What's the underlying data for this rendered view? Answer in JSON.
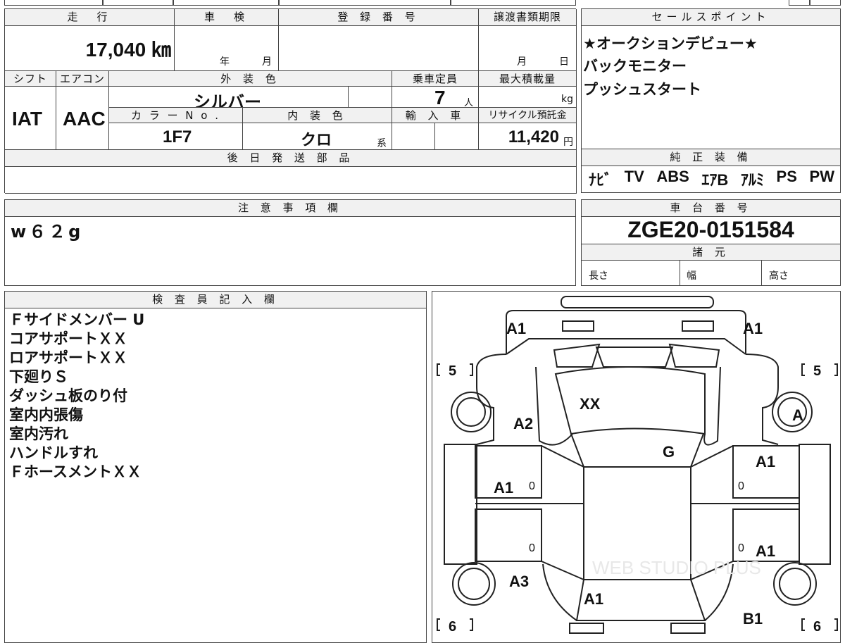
{
  "vehicle": {
    "mileage_label": "走　行",
    "mileage": "17,040 ㎞",
    "inspection_label": "車　検",
    "inspection_year": "年",
    "inspection_month": "月",
    "registration_label": "登 録 番 号",
    "deadline_label": "譲渡書類期限",
    "deadline_month": "月",
    "deadline_day": "日",
    "shift_label": "シフト",
    "shift": "IAT",
    "ac_label": "エアコン",
    "ac": "AAC",
    "exterior_label": "外 装 色",
    "exterior": "シルバー",
    "capacity_label": "乗車定員",
    "capacity": "7",
    "capacity_unit": "人",
    "load_label": "最大積載量",
    "load_unit": "kg",
    "color_no_label": "カ ラ ー N o .",
    "color_no": "1F7",
    "interior_label": "内 装 色",
    "interior": "クロ",
    "interior_suffix": "系",
    "import_label": "輸 入 車",
    "recycle_label": "リサイクル預託金",
    "recycle": "11,420",
    "recycle_unit": "円",
    "parts_label": "後 日 発 送 部 品"
  },
  "sales": {
    "title": "セールスポイント",
    "points": [
      "★オークションデビュー★",
      "バックモニター",
      "プッシュスタート"
    ]
  },
  "equipment": {
    "title": "純 正 装 備",
    "items": [
      "ﾅﾋﾞ",
      "TV",
      "ABS",
      "ｴｱB",
      "ｱﾙﾐ",
      "PS",
      "PW"
    ]
  },
  "notes": {
    "title": "注 意 事 項 欄",
    "text": "w６２g"
  },
  "chassis": {
    "title": "車 台 番 号",
    "number": "ZGE20-0151584",
    "spec_title": "諸 元",
    "length_label": "長さ",
    "width_label": "幅",
    "height_label": "高さ"
  },
  "inspector": {
    "title": "検 査 員 記 入 欄",
    "lines": [
      "Ｆサイドメンバー U",
      "コアサポートＸＸ",
      "ロアサポートＸＸ",
      "下廻りＳ",
      "ダッシュ板のり付",
      "室内内張傷",
      "室内汚れ",
      "ハンドルすれ",
      "ＦホースメントＸＸ"
    ]
  },
  "diagram": {
    "front_left": "A1",
    "front_right": "A1",
    "tire_fl_label": "5",
    "tire_fr_label": "5",
    "tire_rl_label": "6",
    "tire_rr_label": "6",
    "hood": "XX",
    "left_fender": "A2",
    "right_wheel": "A",
    "roof": "G",
    "left_front_door": "A1",
    "right_front_door": "A1",
    "right_rear_door": "A1",
    "left_quarter": "A3",
    "trunk": "A1",
    "right_rear": "B1",
    "pillar_lf": "0",
    "pillar_rf": "0",
    "pillar_lr": "0",
    "pillar_rr": "0",
    "watermark": "WEB STUDIO PLUS"
  }
}
